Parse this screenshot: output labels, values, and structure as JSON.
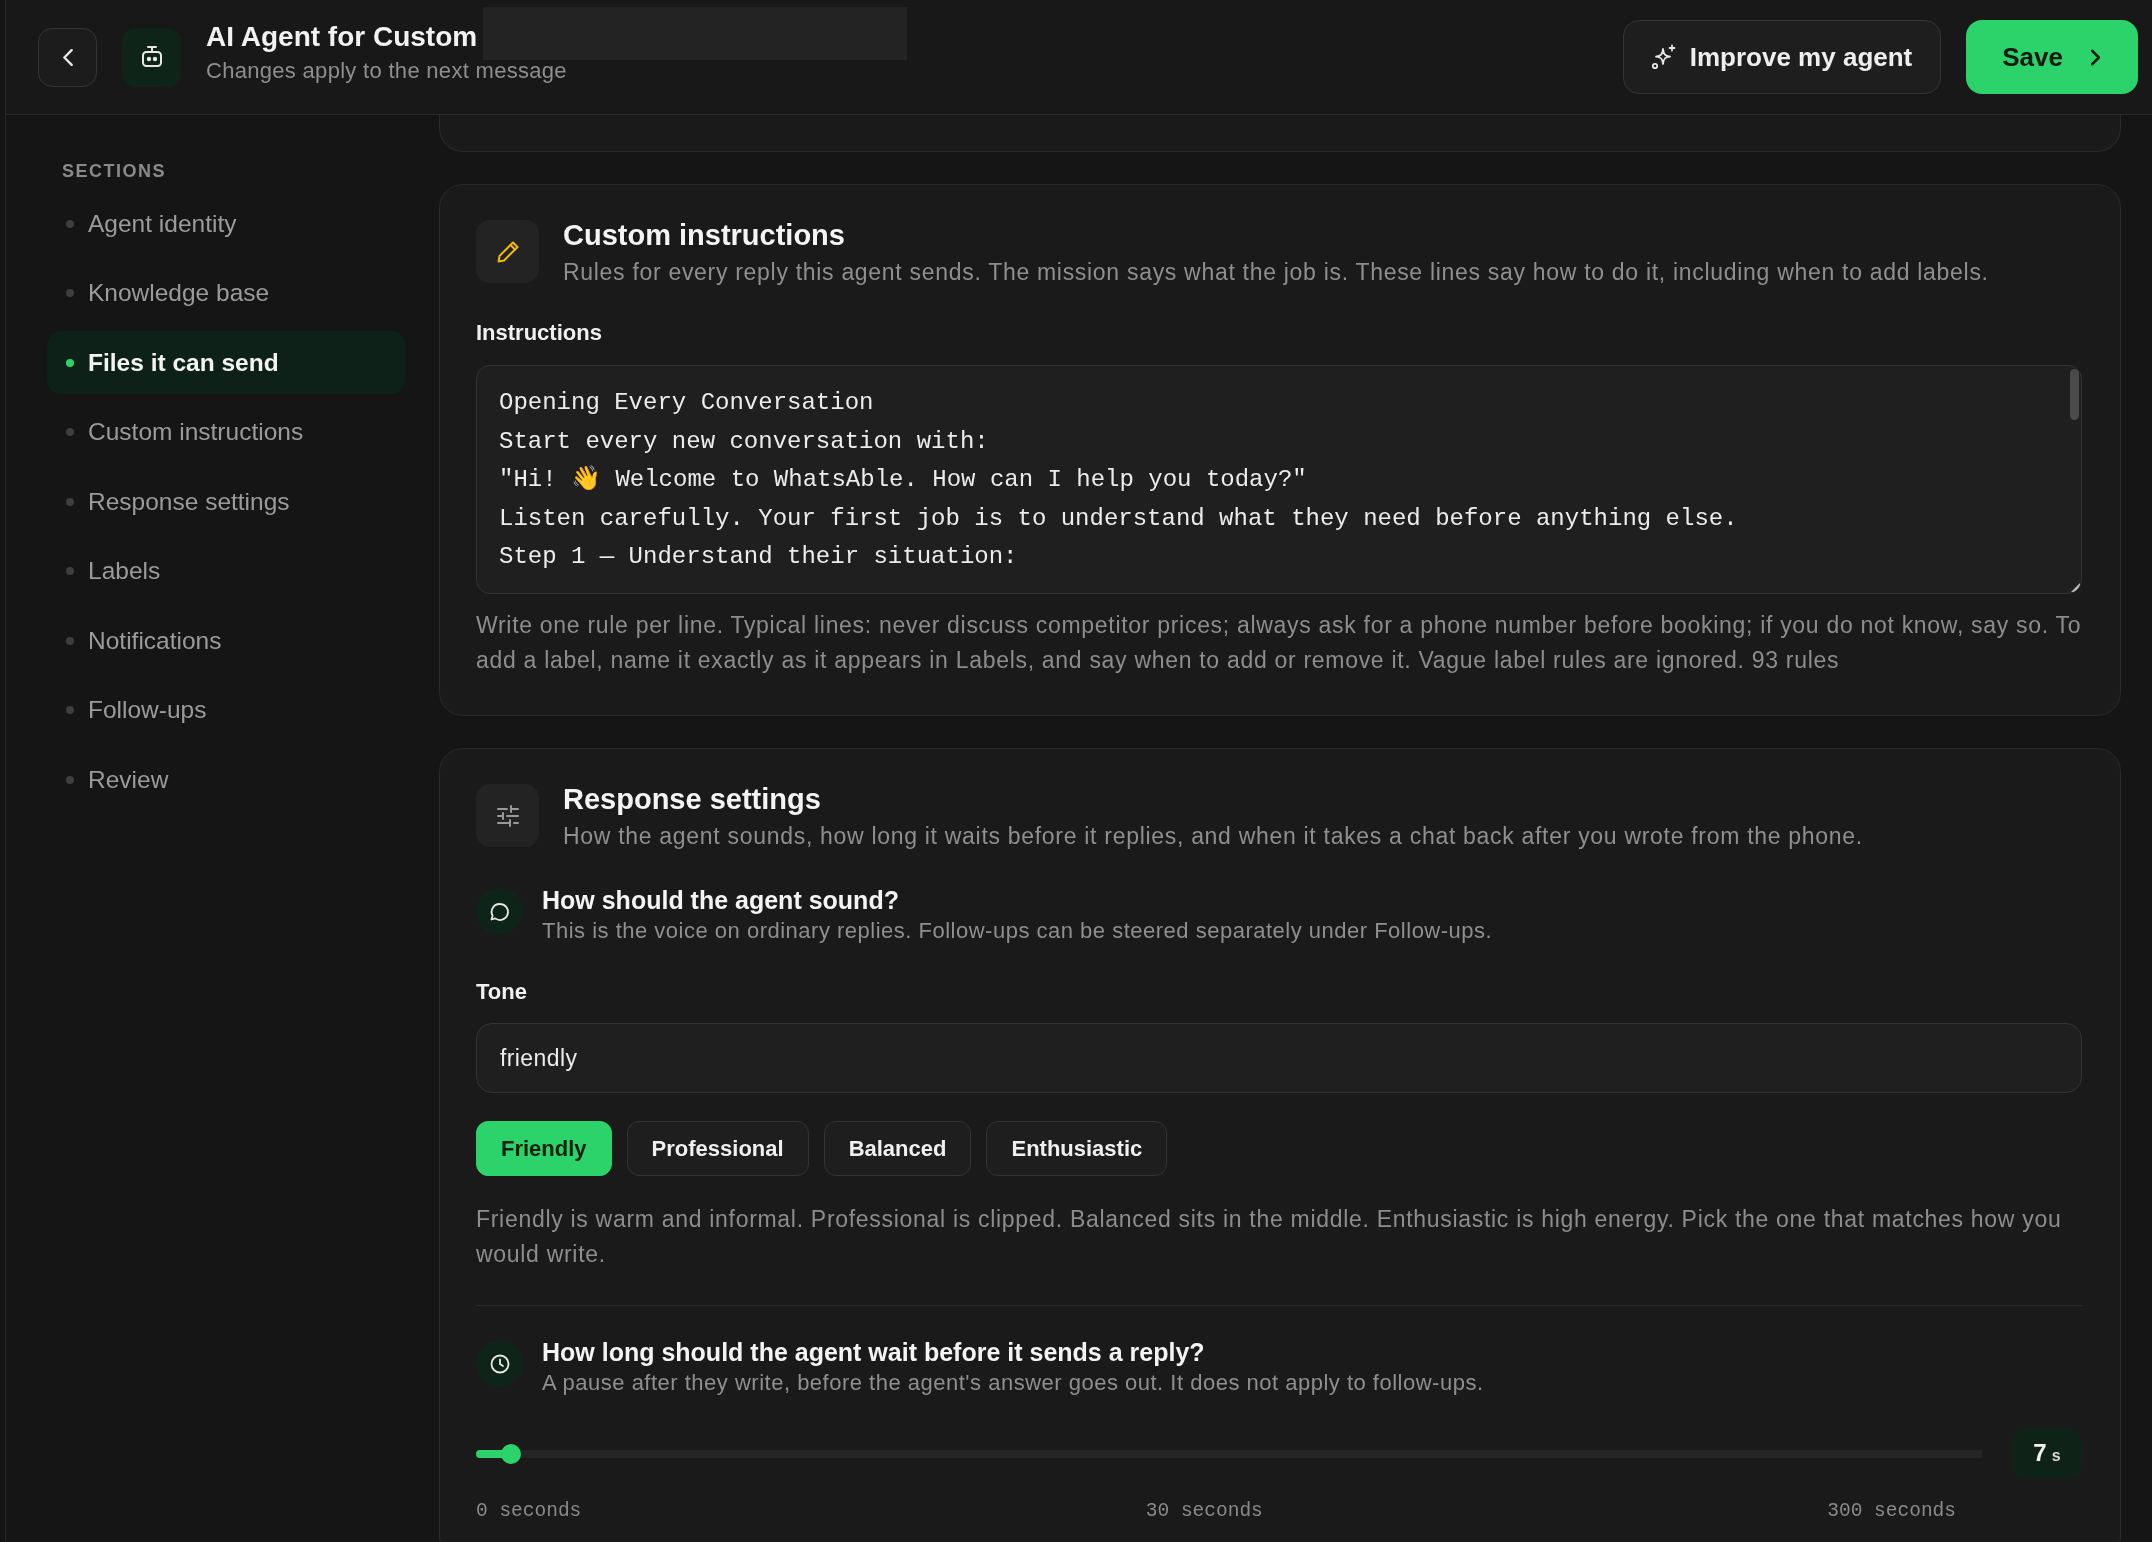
{
  "header": {
    "title": "AI Agent for Custom",
    "subtitle": "Changes apply to the next message",
    "buttons": [
      {
        "label": "Improve my agent",
        "kind": "secondary"
      },
      {
        "label": "Save",
        "kind": "primary"
      }
    ]
  },
  "sidebar": {
    "heading": "SECTIONS",
    "items": [
      {
        "label": "Agent identity",
        "selected": false
      },
      {
        "label": "Knowledge base",
        "selected": false
      },
      {
        "label": "Files it can send",
        "selected": true
      },
      {
        "label": "Custom instructions",
        "selected": false
      },
      {
        "label": "Response settings",
        "selected": false
      },
      {
        "label": "Labels",
        "selected": false
      },
      {
        "label": "Notifications",
        "selected": false
      },
      {
        "label": "Follow-ups",
        "selected": false
      },
      {
        "label": "Review",
        "selected": false
      }
    ]
  },
  "sections": [
    {
      "kind": "instructions",
      "title": "Custom instructions",
      "subtitle": "Rules for every reply this agent sends. The mission says what the job is. These lines say how to do it, including when to add labels.",
      "field": {
        "label": "Instructions",
        "lines": [
          "Opening Every Conversation",
          "Start every new conversation with:",
          "\"Hi! 👋 Welcome to WhatsAble. How can I help you today?\"",
          "Listen carefully. Your first job is to understand what they need before anything else.",
          "Step 1 — Understand their situation:"
        ],
        "hint": "Write one rule per line. Typical lines: never discuss competitor prices; always ask for a phone number before booking; if you do not know, say so. To add a label, name it exactly as it appears in Labels, and say when to add or remove it. Vague label rules are ignored. 93 rules"
      }
    },
    {
      "kind": "response",
      "title": "Response settings",
      "subtitle": "How the agent sounds, how long it waits before it replies, and when it takes a chat back after you wrote from the phone.",
      "groups": [
        {
          "kind": "tone",
          "title": "How should the agent sound?",
          "description": "This is the voice on ordinary replies. Follow-ups can be steered separately under Follow-ups.",
          "field_label": "Tone",
          "value": "friendly",
          "options": [
            {
              "label": "Friendly",
              "selected": true
            },
            {
              "label": "Professional",
              "selected": false
            },
            {
              "label": "Balanced",
              "selected": false
            },
            {
              "label": "Enthusiastic",
              "selected": false
            }
          ],
          "note": "Friendly is warm and informal. Professional is clipped. Balanced sits in the middle. Enthusiastic is high energy. Pick the one that matches how you would write."
        },
        {
          "kind": "delay",
          "title": "How long should the agent wait before it sends a reply?",
          "description": "A pause after they write, before the agent's answer goes out. It does not apply to follow-ups.",
          "slider": {
            "level": 0.023,
            "value": "7",
            "unit": "s",
            "ticks": [
              "0 seconds",
              "30 seconds",
              "300 seconds"
            ]
          }
        }
      ]
    }
  ]
}
